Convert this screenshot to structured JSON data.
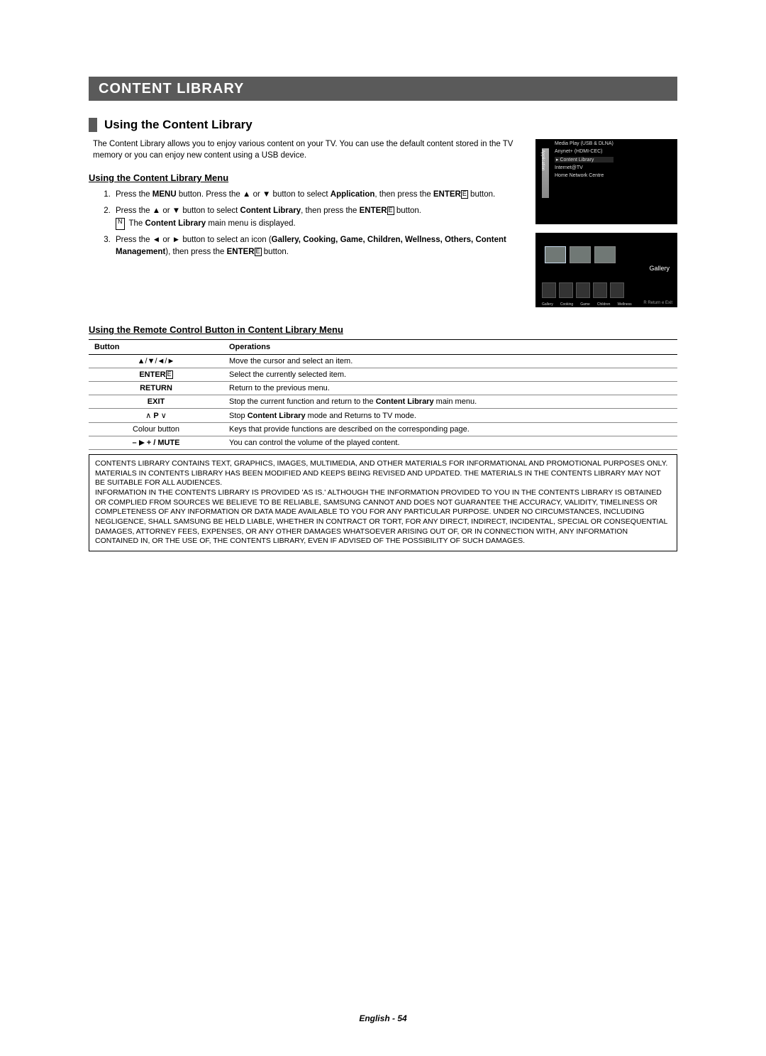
{
  "title_bar": "CONTENT LIBRARY",
  "section_title": "Using the Content Library",
  "intro": "The Content Library allows you to enjoy various content on your TV. You can use the default content stored in the TV memory or you can enjoy new content using a USB device.",
  "subheading1": "Using the Content Library Menu",
  "steps": {
    "s1_a": "Press the ",
    "s1_menu": "MENU",
    "s1_b": " button. Press the ▲ or ▼ button to select ",
    "s1_app": "Application",
    "s1_c": ", then press the ",
    "s1_enter": "ENTER",
    "s1_d": " button.",
    "s2_a": "Press the ▲ or ▼ button to select ",
    "s2_cl": "Content Library",
    "s2_b": ", then press the ",
    "s2_enter": "ENTER",
    "s2_c": " button.",
    "s2_note_a": "The ",
    "s2_note_b": "Content Library",
    "s2_note_c": " main menu is displayed.",
    "s3_a": "Press the ◄ or ► button to select an icon (",
    "s3_b": "Gallery, Cooking, Game, Children, Wellness, Others, Content Management",
    "s3_c": "), then press the ",
    "s3_enter": "ENTER",
    "s3_d": " button."
  },
  "screenshot1": {
    "sidebar_label": "Application",
    "items": [
      "Media Play (USB & DLNA)",
      "Anynet+ (HDMI-CEC)",
      "Content Library",
      "Internet@TV",
      "Home Network Centre"
    ]
  },
  "screenshot2": {
    "gallery": "Gallery",
    "bottom_icons": [
      "Gallery",
      "Cooking",
      "Game",
      "Children",
      "Wellness"
    ],
    "footer": "R Return   e Exit"
  },
  "subheading2": "Using the Remote Control Button in Content Library Menu",
  "table": {
    "headers": [
      "Button",
      "Operations"
    ],
    "rows": [
      {
        "button_html": "▲/▼/◄/►",
        "op": "Move the cursor and select an item."
      },
      {
        "button_html": "ENTER_ICON",
        "op": "Select the currently selected item."
      },
      {
        "button_html": "RETURN_B",
        "op": "Return to the previous menu."
      },
      {
        "button_html": "EXIT_B",
        "op_b": "Stop the current function and return to the ",
        "op_strong": "Content Library",
        "op_c": " main menu."
      },
      {
        "button_html": "PCH",
        "op_b": "Stop ",
        "op_strong": "Content Library",
        "op_c": " mode and Returns to TV mode."
      },
      {
        "button_html": "Colour button",
        "op": "Keys that provide functions are described on the corresponding page."
      },
      {
        "button_html": "VOLMUTE",
        "op": "You can control the volume of the played content."
      }
    ],
    "enter_label": "ENTER",
    "return_label": "RETURN",
    "exit_label": "EXIT",
    "pch_label": "P",
    "mute_suffix": " / MUTE"
  },
  "disclaimer": "CONTENTS LIBRARY CONTAINS TEXT, GRAPHICS, IMAGES, MULTIMEDIA, AND OTHER MATERIALS FOR INFORMATIONAL AND PROMOTIONAL PURPOSES ONLY. MATERIALS IN CONTENTS LIBRARY HAS BEEN MODIFIED AND KEEPS BEING REVISED AND UPDATED. THE MATERIALS IN THE CONTENTS LIBRARY MAY NOT BE SUITABLE FOR ALL AUDIENCES.\nINFORMATION IN THE CONTENTS LIBRARY IS PROVIDED 'AS IS.' ALTHOUGH THE INFORMATION PROVIDED TO YOU IN THE CONTENTS LIBRARY IS OBTAINED OR COMPLIED FROM SOURCES WE BELIEVE TO BE RELIABLE, SAMSUNG CANNOT AND DOES NOT GUARANTEE THE ACCURACY, VALIDITY, TIMELINESS OR COMPLETENESS OF ANY INFORMATION OR DATA MADE AVAILABLE TO YOU FOR ANY PARTICULAR PURPOSE. UNDER NO CIRCUMSTANCES, INCLUDING NEGLIGENCE, SHALL SAMSUNG BE HELD LIABLE, WHETHER IN CONTRACT OR TORT, FOR ANY DIRECT, INDIRECT, INCIDENTAL, SPECIAL OR CONSEQUENTIAL DAMAGES, ATTORNEY FEES, EXPENSES, OR ANY OTHER DAMAGES WHATSOEVER ARISING OUT OF, OR IN CONNECTION WITH, ANY INFORMATION CONTAINED IN, OR THE USE OF, THE CONTENTS LIBRARY, EVEN IF ADVISED OF THE POSSIBILITY OF SUCH DAMAGES.",
  "footer": "English - 54"
}
